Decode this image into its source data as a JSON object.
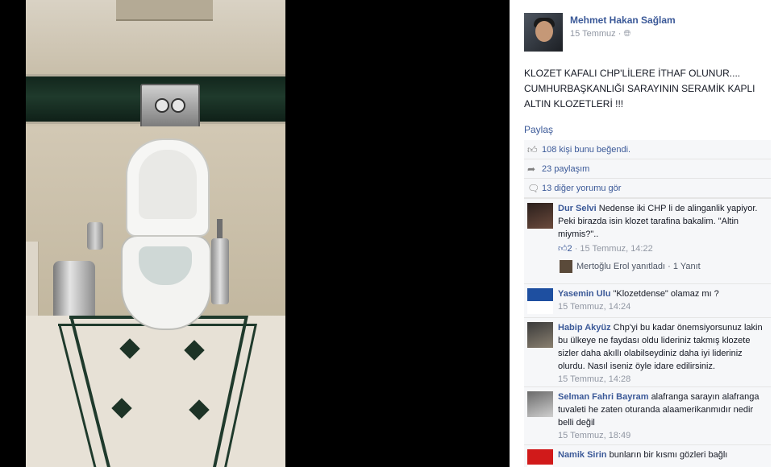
{
  "post": {
    "author": "Mehmet Hakan Sağlam",
    "date": "15 Temmuz",
    "separator": "·",
    "globe_icon": "globe-icon",
    "text": "KLOZET KAFALI CHP'LİLERE İTHAF OLUNUR.... CUMHURBAŞKANLIĞI SARAYININ SERAMİK KAPLI ALTIN KLOZETLERİ !!!",
    "share_label": "Paylaş"
  },
  "ufi": {
    "likes_text": "108 kişi bunu beğendi.",
    "shares_text": "23 paylaşım",
    "more_comments_text": "13 diğer yorumu gör"
  },
  "comments": [
    {
      "name": "Dur Selvi",
      "text": "Nedense iki CHP li de alinganlik yapiyor. Peki birazda isin klozet tarafina bakalim. \"Altin miymis?\"..",
      "likes": "2",
      "separator": "·",
      "time": "15 Temmuz, 14:22",
      "reply": {
        "text": "Mertoğlu Erol yanıtladı",
        "separator": "·",
        "count": "1 Yanıt"
      }
    },
    {
      "name": "Yasemin Ulu",
      "text": "\"Klozetdense\" olamaz mı ?",
      "time": "15 Temmuz, 14:24"
    },
    {
      "name": "Habip Akyüz",
      "text": "Chp'yi bu kadar önemsiyorsunuz lakin bu ülkeye ne faydası oldu lideriniz takmış klozete sizler daha akıllı olabilseydiniz daha iyi lideriniz olurdu. Nasıl iseniz öyle idare edilirsiniz.",
      "time": "15 Temmuz, 14:28"
    },
    {
      "name": "Selman Fahri Bayram",
      "text": "alafranga sarayın alafranga tuvaleti he zaten oturanda alaamerikanmıdır nedir belli değil",
      "time": "15 Temmuz, 18:49"
    },
    {
      "name": "Namik Sirin",
      "text": "bunların bir kısmı gözleri bağlı"
    }
  ],
  "colors": {
    "link": "#3b5998",
    "meta": "#9197a3",
    "ufi_bg": "#f6f7f9"
  }
}
